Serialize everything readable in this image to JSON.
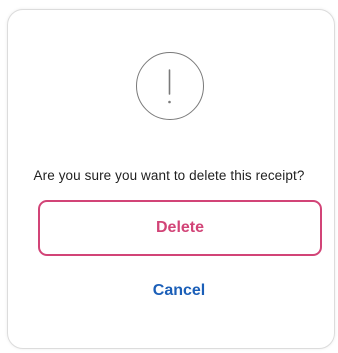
{
  "dialog": {
    "icon": "exclamation-circle-icon",
    "message": "Are you sure you want to delete this receipt?",
    "delete_label": "Delete",
    "cancel_label": "Cancel"
  },
  "colors": {
    "delete_accent": "#d24477",
    "cancel_link": "#1b5fb8",
    "icon_stroke": "#7a7a7a"
  }
}
